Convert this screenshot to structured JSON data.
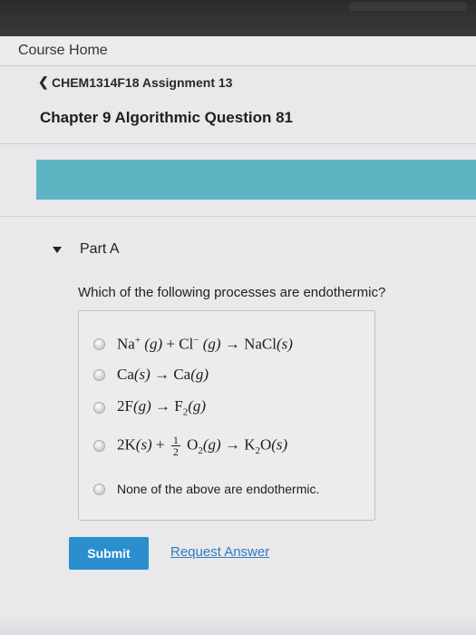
{
  "course_nav": {
    "label": "Course Home"
  },
  "breadcrumb": {
    "chevron": "❮",
    "label": "CHEM1314F18 Assignment 13"
  },
  "page": {
    "title": "Chapter 9 Algorithmic Question 81"
  },
  "part": {
    "label": "Part A",
    "toggle_icon": "triangle-down-icon"
  },
  "question": {
    "text": "Which of the following processes are endothermic?"
  },
  "options": {
    "opt1": {
      "na": "Na",
      "plus_sup": "+",
      "g1": "(g)",
      "plus": "+",
      "cl": "Cl",
      "minus_sup": "−",
      "g2": "(g)",
      "arrow": "→",
      "product": "NaCl",
      "s": "(s)"
    },
    "opt2": {
      "ca1": "Ca",
      "s": "(s)",
      "arrow": "→",
      "ca2": "Ca",
      "g": "(g)"
    },
    "opt3": {
      "coef": "2F",
      "g1": "(g)",
      "arrow": "→",
      "f": "F",
      "sub": "2",
      "g2": "(g)"
    },
    "opt4": {
      "coef": "2K",
      "s1": "(s)",
      "plus": "+",
      "num": "1",
      "den": "2",
      "o": "O",
      "sub": "2",
      "g": "(g)",
      "arrow": "→",
      "k": "K",
      "k_sub": "2",
      "o2": "O",
      "s2": "(s)"
    },
    "opt5": {
      "text": "None of the above are endothermic."
    }
  },
  "actions": {
    "submit": "Submit",
    "request": "Request Answer"
  },
  "colors": {
    "accent": "#2b8fcf",
    "band": "#5fb4c4",
    "link": "#2f7dc2"
  }
}
